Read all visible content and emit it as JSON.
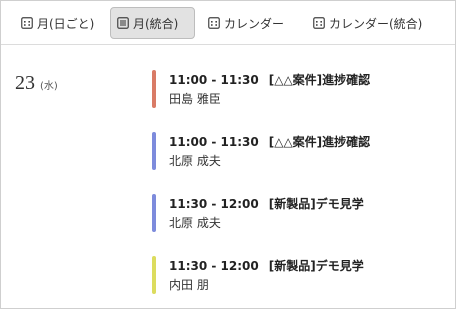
{
  "toolbar": {
    "tabs": [
      {
        "label": "月(日ごと)",
        "icon": "calendar-grid-icon"
      },
      {
        "label": "月(統合)",
        "icon": "list-icon"
      },
      {
        "label": "カレンダー",
        "icon": "calendar-grid-icon"
      },
      {
        "label": "カレンダー(統合)",
        "icon": "calendar-grid-icon"
      }
    ],
    "active_tab": "月(統合)"
  },
  "day": {
    "number": "23",
    "weekday": "(水)"
  },
  "events": [
    {
      "time": "11:00 - 11:30",
      "title": "[△△案件]進捗確認",
      "person": "田島 雅臣",
      "color": "#d97b66"
    },
    {
      "time": "11:00 - 11:30",
      "title": "[△△案件]進捗確認",
      "person": "北原 成夫",
      "color": "#7d8bdc"
    },
    {
      "time": "11:30 - 12:00",
      "title": "[新製品]デモ見学",
      "person": "北原 成夫",
      "color": "#7d8bdc"
    },
    {
      "time": "11:30 - 12:00",
      "title": "[新製品]デモ見学",
      "person": "内田 朋",
      "color": "#dcdc5e"
    }
  ]
}
